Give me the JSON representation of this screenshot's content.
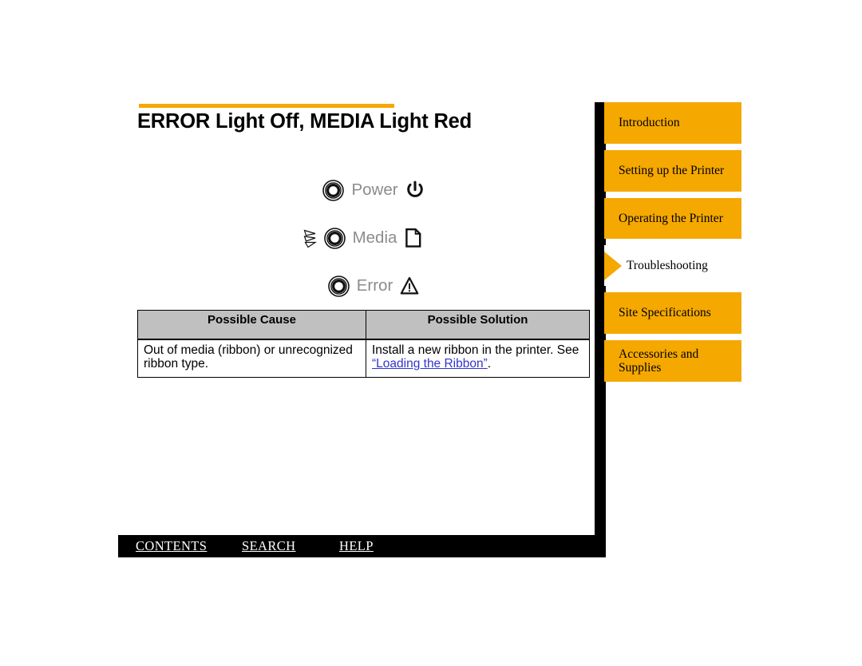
{
  "page": {
    "title": "ERROR Light Off, MEDIA Light Red",
    "accent_color": "#F5A800",
    "link_color": "#3333CC",
    "spine_color": "#000000"
  },
  "indicators": {
    "items": [
      {
        "label": "Power",
        "glyph": "power-symbol",
        "lit": false
      },
      {
        "label": "Media",
        "glyph": "page-document",
        "lit": true
      },
      {
        "label": "Error",
        "glyph": "warning-triangle",
        "lit": false
      }
    ],
    "label_color": "#8c8c8c"
  },
  "table": {
    "headers": [
      "Possible Cause",
      "Possible Solution"
    ],
    "rows": [
      {
        "cause": "Out of media (ribbon) or unrecognized ribbon type.",
        "solution_before": "Install a new ribbon in the printer. See ",
        "solution_link": "“Loading the Ribbon”",
        "solution_after": "."
      }
    ]
  },
  "sidebar": {
    "items": [
      {
        "label": "Introduction",
        "active": false
      },
      {
        "label": "Setting up the Printer",
        "active": false
      },
      {
        "label": "Operating the Printer",
        "active": false
      },
      {
        "label": "Troubleshooting",
        "active": true
      },
      {
        "label": "Site Specifications",
        "active": false
      },
      {
        "label": "Accessories and Supplies",
        "active": false
      }
    ]
  },
  "bottom_bar": {
    "contents": "CONTENTS",
    "search": "SEARCH",
    "help": "HELP"
  }
}
